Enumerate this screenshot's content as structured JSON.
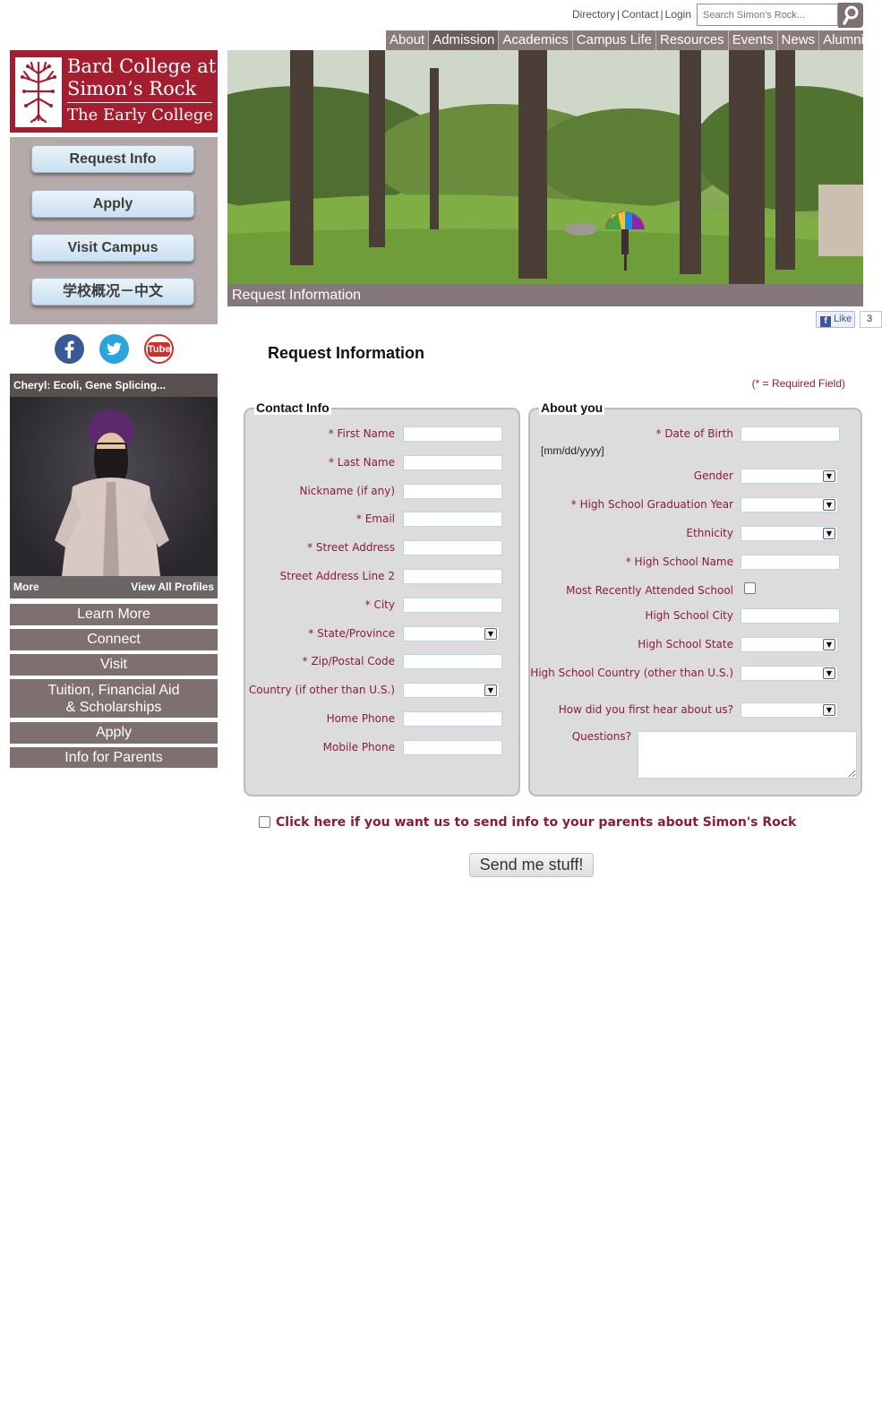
{
  "utility": {
    "directory": "Directory",
    "contact": "Contact",
    "login": "Login",
    "separator": "|",
    "search_placeholder": "Search Simon's Rock..."
  },
  "topnav": {
    "items": [
      {
        "label": "About"
      },
      {
        "label": "Admission",
        "active": true
      },
      {
        "label": "Academics"
      },
      {
        "label": "Campus Life"
      },
      {
        "label": "Resources"
      },
      {
        "label": "Events"
      },
      {
        "label": "News"
      },
      {
        "label": "Alumni"
      }
    ]
  },
  "logo": {
    "line1": "Bard College at",
    "line2": "Simon’s Rock",
    "line3": "The Early College",
    "brand_color": "#a41e2f"
  },
  "sidebar": {
    "buttons": [
      {
        "label": "Request Info"
      },
      {
        "label": "Apply"
      },
      {
        "label": "Visit Campus"
      },
      {
        "label": "学校概况－中文"
      }
    ],
    "social": [
      {
        "icon": "facebook-icon",
        "color": "#3b5998"
      },
      {
        "icon": "twitter-icon",
        "color": "#2aa4dc"
      },
      {
        "icon": "youtube-icon",
        "color": "#d62b26",
        "text": "Tube"
      }
    ],
    "profile": {
      "title": "Cheryl: Ecoli, Gene Splicing...",
      "more": "More",
      "view_all": "View All Profiles"
    },
    "menu": [
      {
        "label": "Learn More"
      },
      {
        "label": "Connect"
      },
      {
        "label": "Visit"
      },
      {
        "label": "Tuition, Financial Aid\n& Scholarships"
      },
      {
        "label": "Apply"
      },
      {
        "label": "Info for Parents"
      }
    ]
  },
  "hero": {
    "caption": "Request Information"
  },
  "facebook": {
    "like_label": "Like",
    "count": "3"
  },
  "form": {
    "title": "Request Information",
    "required_note": "(* = Required Field)",
    "contact": {
      "legend": "Contact Info",
      "fields": [
        {
          "label": "First Name",
          "required": true,
          "type": "text"
        },
        {
          "label": "Last Name",
          "required": true,
          "type": "text"
        },
        {
          "label": "Nickname (if any)",
          "required": false,
          "type": "text"
        },
        {
          "label": "Email",
          "required": true,
          "type": "text"
        },
        {
          "label": "Street Address",
          "required": true,
          "type": "text"
        },
        {
          "label": "Street Address Line 2",
          "required": false,
          "type": "text"
        },
        {
          "label": "City",
          "required": true,
          "type": "text"
        },
        {
          "label": "State/Province",
          "required": true,
          "type": "select"
        },
        {
          "label": "Zip/Postal Code",
          "required": true,
          "type": "text"
        },
        {
          "label": "Country (if other than U.S.)",
          "required": false,
          "type": "select"
        },
        {
          "label": "Home Phone",
          "required": false,
          "type": "text"
        },
        {
          "label": "Mobile Phone",
          "required": false,
          "type": "text"
        }
      ]
    },
    "about": {
      "legend": "About you",
      "dob_label": "Date of Birth",
      "dob_hint": "[mm/dd/yyyy]",
      "fields": [
        {
          "label": "Gender",
          "required": false,
          "type": "select"
        },
        {
          "label": "High School Graduation Year",
          "required": true,
          "type": "select"
        },
        {
          "label": "Ethnicity",
          "required": false,
          "type": "select"
        },
        {
          "label": "High School Name",
          "required": true,
          "type": "text"
        },
        {
          "label": "Most Recently Attended School",
          "required": false,
          "type": "checkbox"
        },
        {
          "label": "High School City",
          "required": false,
          "type": "text"
        },
        {
          "label": "High School State",
          "required": false,
          "type": "select"
        },
        {
          "label": "High School Country (other than U.S.)",
          "required": false,
          "type": "select"
        }
      ],
      "hear_label": "How did you first hear about us?",
      "questions_label": "Questions?"
    },
    "parents_label": "Click here if you want us to send info to your parents about Simon's Rock",
    "submit_label": "Send me stuff!",
    "accent_color": "#8a1c3a"
  }
}
